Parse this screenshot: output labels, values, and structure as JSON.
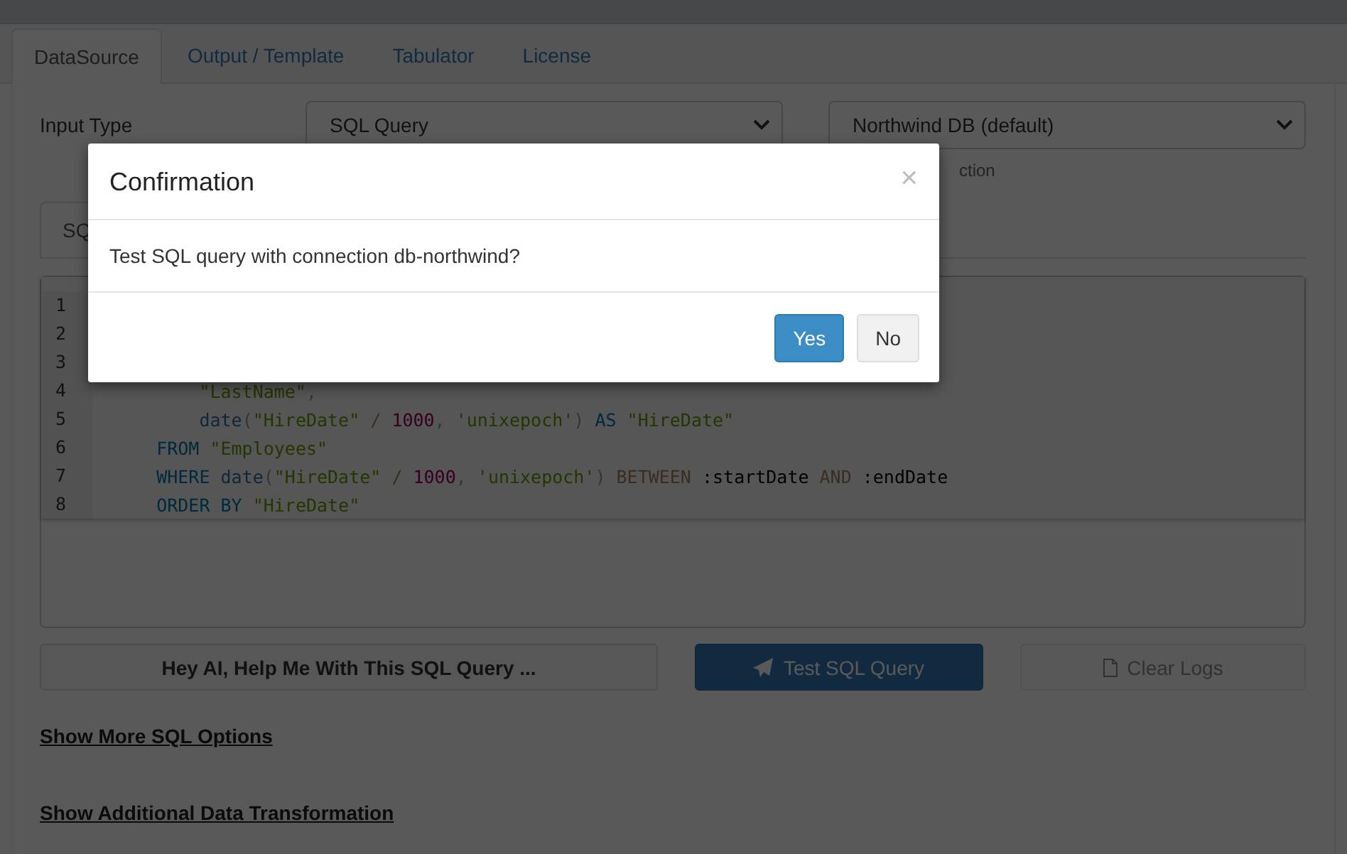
{
  "tabs": [
    {
      "label": "DataSource",
      "selected": true
    },
    {
      "label": "Output / Template",
      "selected": false
    },
    {
      "label": "Tabulator",
      "selected": false
    },
    {
      "label": "License",
      "selected": false
    }
  ],
  "input_type": {
    "label": "Input Type",
    "type_select": "SQL Query",
    "connection_select": "Northwind DB (default)",
    "connection_hint": "ction"
  },
  "editor_tabs": [
    {
      "label": "SQ",
      "selected": true
    }
  ],
  "editor": {
    "lines": [
      {
        "number": "1"
      },
      {
        "number": "2"
      },
      {
        "number": "3"
      },
      {
        "number": "4",
        "tokens": [
          {
            "kind": "str",
            "text": "        \"LastName\""
          },
          {
            "kind": "punc",
            "text": ","
          }
        ]
      },
      {
        "number": "5",
        "tokens": [
          {
            "kind": "fn",
            "text": "        date"
          },
          {
            "kind": "punc",
            "text": "("
          },
          {
            "kind": "str",
            "text": "\"HireDate\""
          },
          {
            "kind": "op",
            "text": " / "
          },
          {
            "kind": "num",
            "text": "1000"
          },
          {
            "kind": "punc",
            "text": ", "
          },
          {
            "kind": "str",
            "text": "'unixepoch'"
          },
          {
            "kind": "punc",
            "text": ")"
          },
          {
            "kind": "kw",
            "text": " AS "
          },
          {
            "kind": "str",
            "text": "\"HireDate\""
          }
        ]
      },
      {
        "number": "6",
        "tokens": [
          {
            "kind": "kw",
            "text": "    FROM "
          },
          {
            "kind": "str",
            "text": "\"Employees\""
          }
        ]
      },
      {
        "number": "7",
        "tokens": [
          {
            "kind": "kw",
            "text": "    WHERE "
          },
          {
            "kind": "fn",
            "text": "date"
          },
          {
            "kind": "punc",
            "text": "("
          },
          {
            "kind": "str",
            "text": "\"HireDate\""
          },
          {
            "kind": "op",
            "text": " / "
          },
          {
            "kind": "num",
            "text": "1000"
          },
          {
            "kind": "punc",
            "text": ", "
          },
          {
            "kind": "str",
            "text": "'unixepoch'"
          },
          {
            "kind": "punc",
            "text": ")"
          },
          {
            "kind": "opkw",
            "text": " BETWEEN"
          },
          {
            "kind": "plain",
            "text": " :startDate "
          },
          {
            "kind": "opkw",
            "text": "AND"
          },
          {
            "kind": "plain",
            "text": " :endDate"
          }
        ]
      },
      {
        "number": "8",
        "tokens": [
          {
            "kind": "kw",
            "text": "    ORDER BY "
          },
          {
            "kind": "str",
            "text": "\"HireDate\""
          }
        ]
      }
    ]
  },
  "actions": [
    {
      "kind": "ai",
      "label": "Hey AI, Help Me With This SQL Query ...",
      "disabled": false
    },
    {
      "kind": "test",
      "label": "Test SQL Query",
      "disabled": false
    },
    {
      "kind": "clear",
      "label": "Clear Logs",
      "disabled": true
    }
  ],
  "links": [
    "Show More SQL Options",
    "Show Additional Data Transformation"
  ],
  "modal": {
    "title": "Confirmation",
    "close": "×",
    "message": "Test SQL query with connection db-northwind?",
    "buttons": [
      {
        "label": "Yes",
        "kind": "primary"
      },
      {
        "label": "No",
        "kind": "default"
      }
    ]
  }
}
